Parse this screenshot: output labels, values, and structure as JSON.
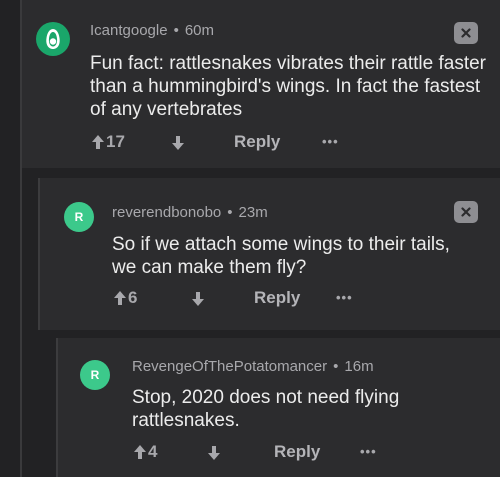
{
  "comments": [
    {
      "username": "Icantgoogle",
      "separator": "•",
      "time": "60m",
      "text": "Fun fact: rattlesnakes vibrates their rattle faster than a hummingbird's wings. In fact the fastest of any vertebrates",
      "upvotes": "17",
      "reply_label": "Reply",
      "more_label": "•••",
      "avatar_color": "#1aa66a",
      "avatar_icon": "avocado-icon"
    },
    {
      "username": "reverendbonobo",
      "separator": "•",
      "time": "23m",
      "text": "So if we attach some wings to their tails, we can make them fly?",
      "upvotes": "6",
      "reply_label": "Reply",
      "more_label": "•••",
      "avatar_color": "#3cc98b",
      "avatar_letter": "R"
    },
    {
      "username": "RevengeOfThePotatomancer",
      "separator": "•",
      "time": "16m",
      "text": "Stop, 2020 does not need flying rattlesnakes.",
      "upvotes": "4",
      "reply_label": "Reply",
      "more_label": "•••",
      "avatar_color": "#3cc98b",
      "avatar_letter": "R"
    }
  ],
  "colors": {
    "background": "#222224",
    "card": "#2c2c2e",
    "meta_text": "#a8a8ac",
    "body_text": "#ececec"
  }
}
